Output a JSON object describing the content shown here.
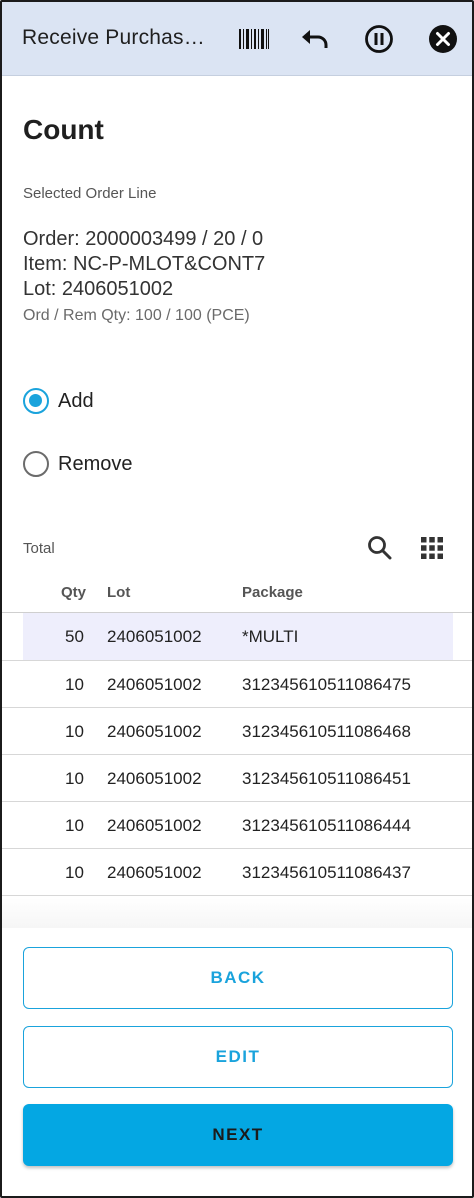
{
  "appbar": {
    "title": "Receive Purchas…",
    "icons": [
      "barcode-icon",
      "undo-icon",
      "pause-icon",
      "close-icon"
    ]
  },
  "page": {
    "title": "Count",
    "selected_label": "Selected Order Line",
    "order": "Order: 2000003499 / 20 / 0",
    "item": "Item: NC-P-MLOT&CONT7",
    "lot": "Lot: 2406051002",
    "qty": "Ord / Rem Qty: 100 / 100 (PCE)"
  },
  "mode": {
    "options": [
      {
        "label": "Add",
        "selected": true
      },
      {
        "label": "Remove",
        "selected": false
      }
    ]
  },
  "total": {
    "label": "Total",
    "icons": [
      "search-icon",
      "grid-icon"
    ]
  },
  "table": {
    "headers": {
      "qty": "Qty",
      "lot": "Lot",
      "package": "Package"
    },
    "rows": [
      {
        "qty": "50",
        "lot": "2406051002",
        "package": "*MULTI",
        "highlighted": true
      },
      {
        "qty": "10",
        "lot": "2406051002",
        "package": "312345610511086475"
      },
      {
        "qty": "10",
        "lot": "2406051002",
        "package": "312345610511086468"
      },
      {
        "qty": "10",
        "lot": "2406051002",
        "package": "312345610511086451"
      },
      {
        "qty": "10",
        "lot": "2406051002",
        "package": "312345610511086444"
      },
      {
        "qty": "10",
        "lot": "2406051002",
        "package": "312345610511086437"
      }
    ]
  },
  "buttons": {
    "back": "BACK",
    "edit": "EDIT",
    "next": "NEXT"
  },
  "colors": {
    "accent": "#1aa3dc",
    "appbar_bg": "#dbe4f3",
    "highlight_row": "#eeeefc",
    "primary_button": "#04a7e3"
  }
}
